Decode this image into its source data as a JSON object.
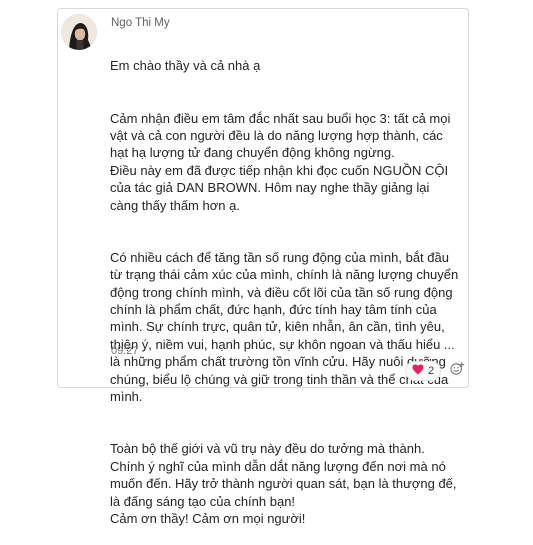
{
  "message": {
    "author": "Ngo Thi My",
    "time": "09:27",
    "paragraphs": [
      "Em chào thầy và cả nhà ạ",
      "Cảm nhận điều em tâm đắc nhất sau buổi học 3: tất cả mọi vật và cả con người đều là do năng lượng hợp thành, các hạt hạ lượng tử đang chuyển động không ngừng.\nĐiều này em đã được tiếp nhận khi đọc cuốn NGUỒN CỘI của tác giả DAN BROWN.  Hôm nay nghe thầy giảng lại càng thấy thấm hơn ạ.",
      "Có nhiều cách để tăng tần số rung động của mình, bắt đầu từ trạng thái cảm xúc của mình, chính là năng lượng chuyển động trong chính mình, và điều cốt lõi của tần số rung động chính là phẩm chất, đức hạnh, đức tính hay tâm tính của mình. Sự chính trực, quân tử, kiên nhẫn, ân cần, tình yêu, thiện ý, niềm vui, hạnh phúc, sự khôn ngoan và thấu hiểu ... là những phẩm chất trường tồn vĩnh cửu. Hãy nuôi dưỡng chúng, biểu lộ chúng và giữ trong tinh thần và thể chất của mình.",
      "Toàn bộ thế giới và vũ trụ này đều do tưởng mà thành. Chính ý nghĩ của mình dẫn dắt năng lượng đến nơi mà nó muốn đến. Hãy trở thành người quan sát, bạn là thượng đế, là đấng sáng tạo của chính bạn!\nCảm ơn thầy! Cảm ơn mọi người!"
    ],
    "reactions": {
      "icon": "heart-icon",
      "count": "2",
      "color": "#e0245e",
      "add_icon": "add-reaction-icon"
    }
  }
}
